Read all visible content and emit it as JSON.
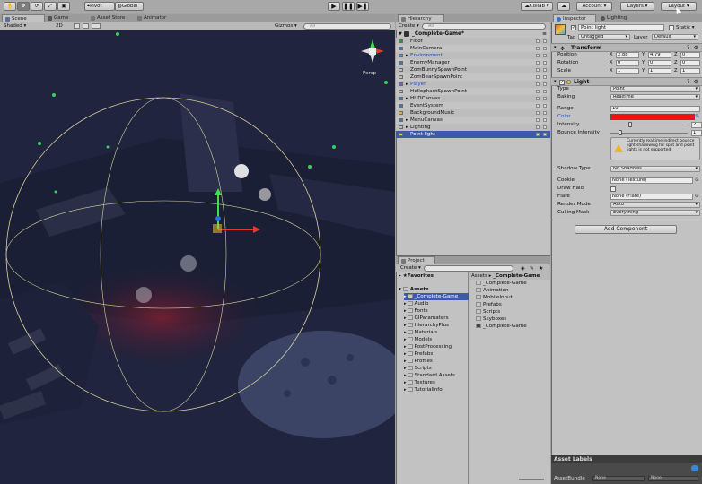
{
  "toolbar": {
    "pivot_label": "Pivot",
    "global_label": "Global",
    "collab_label": "Collab",
    "account_label": "Account",
    "layers_label": "Layers",
    "layout_label": "Layout"
  },
  "scene": {
    "tabs": [
      {
        "label": "Scene"
      },
      {
        "label": "Game"
      },
      {
        "label": "Asset Store"
      },
      {
        "label": "Animator"
      }
    ],
    "shading_mode": "Shaded",
    "mode_2d": "2D",
    "gizmos_label": "Gizmos",
    "search_placeholder": "All",
    "persp_label": "Persp"
  },
  "hierarchy": {
    "tab_label": "Hierarchy",
    "create_label": "Create",
    "search_placeholder": "All",
    "scene_name": "_Complete-Game*",
    "items": [
      {
        "name": "Floor",
        "indent": 1,
        "color": "#111111",
        "selected": false
      },
      {
        "name": "MainCamera",
        "indent": 1,
        "color": "#111111",
        "selected": false
      },
      {
        "name": "Environment",
        "indent": 1,
        "color": "#1f4fc4",
        "selected": false,
        "foldout": true
      },
      {
        "name": "EnemyManager",
        "indent": 1,
        "color": "#111111",
        "selected": false
      },
      {
        "name": "ZomBunnySpawnPoint",
        "indent": 1,
        "color": "#111111",
        "selected": false
      },
      {
        "name": "ZomBearSpawnPoint",
        "indent": 1,
        "color": "#111111",
        "selected": false
      },
      {
        "name": "Player",
        "indent": 1,
        "color": "#1f4fc4",
        "selected": false,
        "foldout": true
      },
      {
        "name": "HellephantSpawnPoint",
        "indent": 1,
        "color": "#111111",
        "selected": false
      },
      {
        "name": "HUDCanvas",
        "indent": 1,
        "color": "#111111",
        "selected": false,
        "foldout": true
      },
      {
        "name": "EventSystem",
        "indent": 1,
        "color": "#111111",
        "selected": false
      },
      {
        "name": "BackgroundMusic",
        "indent": 1,
        "color": "#111111",
        "selected": false
      },
      {
        "name": "MenuCanvas",
        "indent": 1,
        "color": "#111111",
        "selected": false,
        "foldout": true
      },
      {
        "name": "Lighting",
        "indent": 1,
        "color": "#111111",
        "selected": false,
        "foldout": true
      },
      {
        "name": "Point light",
        "indent": 1,
        "color": "#ffffff",
        "selected": true
      }
    ]
  },
  "project": {
    "tab_label": "Project",
    "create_label": "Create",
    "favorites_label": "Favorites",
    "assets_label": "Assets",
    "tree": [
      "_Complete-Game",
      "Audio",
      "Fonts",
      "GIParamaters",
      "HierarchyPlus",
      "Materials",
      "Models",
      "PostProcessing",
      "Prefabs",
      "Profiles",
      "Scripts",
      "Standard Assets",
      "Textures",
      "TutorialInfo"
    ],
    "breadcrumb_root": "Assets",
    "breadcrumb_sep": "▸",
    "breadcrumb_leaf": "_Complete-Game",
    "contents": [
      "_Complete-Game",
      "Animation",
      "MobileInput",
      "Prefabs",
      "Scripts",
      "Skyboxes",
      "_Complete-Game"
    ]
  },
  "inspector": {
    "tabs": [
      {
        "label": "Inspector"
      },
      {
        "label": "Lighting"
      }
    ],
    "object_name": "Point light",
    "static_label": "Static",
    "tag_label": "Tag",
    "tag_value": "Untagged",
    "layer_label": "Layer",
    "layer_value": "Default",
    "transform": {
      "title": "Transform",
      "position_label": "Position",
      "rotation_label": "Rotation",
      "scale_label": "Scale",
      "x_label": "X",
      "y_label": "Y",
      "z_label": "Z",
      "position": {
        "x": "2.88",
        "y": "4.79",
        "z": "0"
      },
      "rotation": {
        "x": "0",
        "y": "0",
        "z": "0"
      },
      "scale": {
        "x": "1",
        "y": "1",
        "z": "1"
      }
    },
    "light": {
      "title": "Light",
      "type_label": "Type",
      "type_value": "Point",
      "baking_label": "Baking",
      "baking_value": "Realtime",
      "range_label": "Range",
      "range_value": "10",
      "color_label": "Color",
      "color_value": "#ee1111",
      "intensity_label": "Intensity",
      "intensity_value": "2",
      "intensity_fraction": 0.25,
      "bounce_label": "Bounce Intensity",
      "bounce_value": "1",
      "bounce_fraction": 0.125,
      "warning_text": "Currently realtime indirect bounce light shadowing for spot and point lights is not supported.",
      "shadow_type_label": "Shadow Type",
      "shadow_type_value": "No Shadows",
      "cookie_label": "Cookie",
      "cookie_value": "None (Texture)",
      "draw_halo_label": "Draw Halo",
      "flare_label": "Flare",
      "flare_value": "None (Flare)",
      "render_mode_label": "Render Mode",
      "render_mode_value": "Auto",
      "culling_mask_label": "Culling Mask",
      "culling_mask_value": "Everything"
    },
    "add_component_label": "Add Component",
    "asset_labels_title": "Asset Labels",
    "asset_bundle_label": "AssetBundle",
    "asset_bundle_value": "None",
    "asset_bundle_variant": "None"
  }
}
